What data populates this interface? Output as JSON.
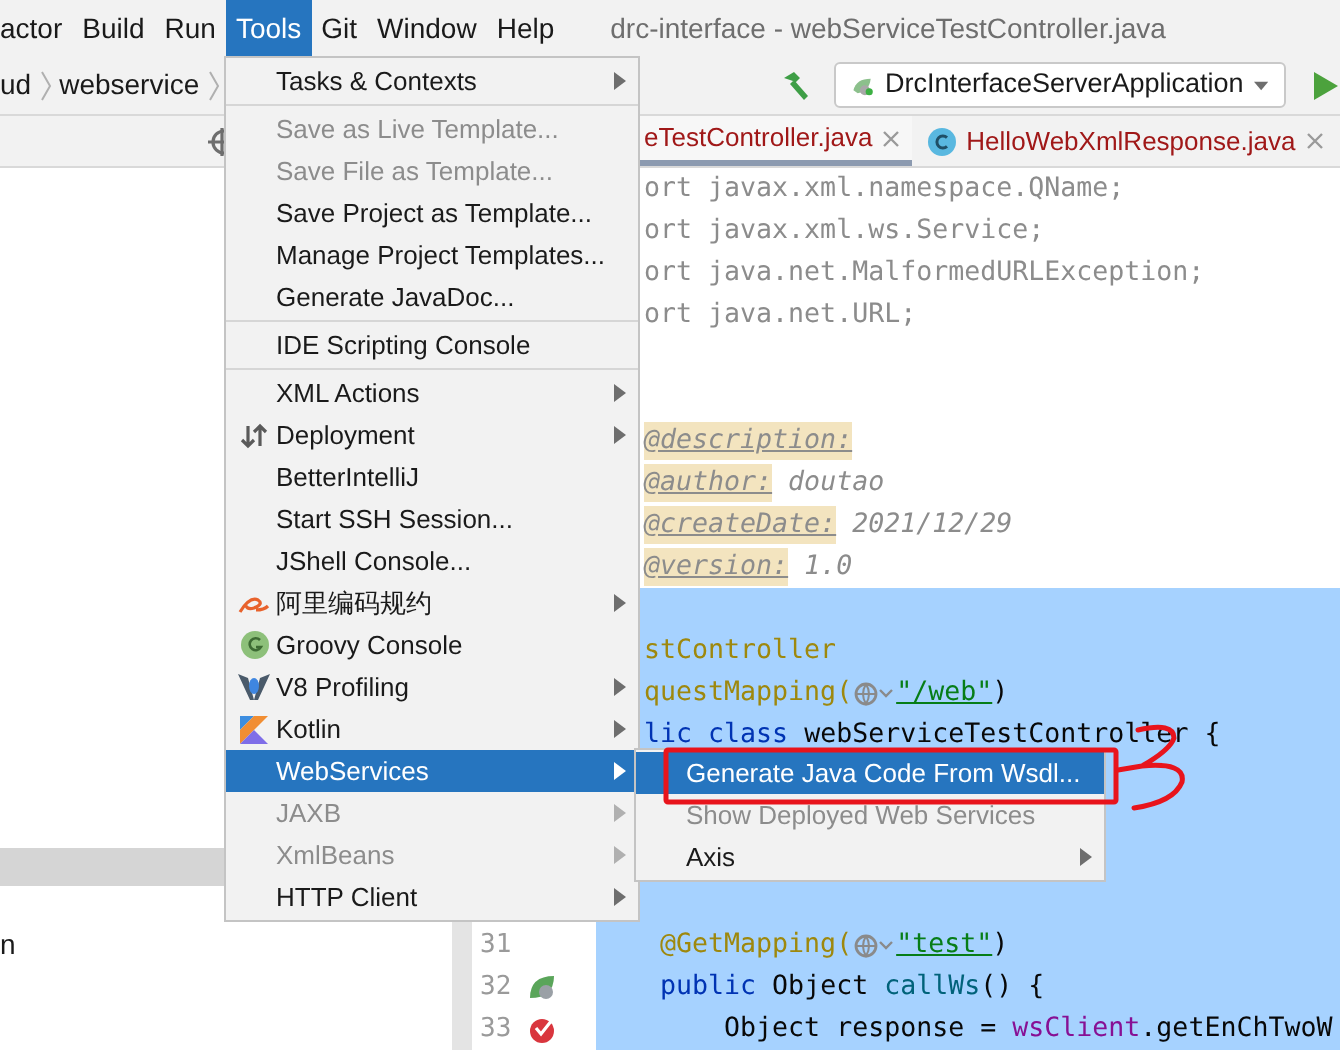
{
  "menu_bar": {
    "items": [
      {
        "label": "actor",
        "selected": false
      },
      {
        "label": "Build",
        "selected": false
      },
      {
        "label": "Run",
        "selected": false
      },
      {
        "label": "Tools",
        "selected": true
      },
      {
        "label": "Git",
        "selected": false
      },
      {
        "label": "Window",
        "selected": false
      },
      {
        "label": "Help",
        "selected": false
      }
    ],
    "title": "drc-interface - webServiceTestController.java"
  },
  "toolbar": {
    "breadcrumbs": [
      "ud",
      "webservice"
    ],
    "run_config": "DrcInterfaceServerApplication"
  },
  "tabs": [
    {
      "label": "eTestController.java",
      "selected": true
    },
    {
      "label": "HelloWebXmlResponse.java",
      "selected": false
    }
  ],
  "project_tree": {
    "rows": [
      {
        "selected": true
      },
      {
        "label": "n",
        "selected": false
      }
    ]
  },
  "editor": {
    "lines": [
      {
        "selected": false,
        "segments": [
          {
            "text": "ort javax.xml.namespace.QName;",
            "kind": "unused"
          }
        ]
      },
      {
        "selected": false,
        "segments": [
          {
            "text": "ort javax.xml.ws.Service;",
            "kind": "unused"
          }
        ]
      },
      {
        "selected": false,
        "segments": [
          {
            "text": "ort java.net.MalformedURLException;",
            "kind": "unused"
          }
        ]
      },
      {
        "selected": false,
        "segments": [
          {
            "text": "ort java.net.URL;",
            "kind": "unused"
          }
        ]
      },
      {
        "selected": false
      },
      {
        "selected": false
      },
      {
        "selected": false,
        "segments": [
          {
            "text": "@description:",
            "kind": "doctag"
          }
        ]
      },
      {
        "selected": false,
        "segments": [
          {
            "text": "@author:",
            "kind": "doctag"
          },
          {
            "text": " doutao",
            "kind": "docvalue"
          }
        ]
      },
      {
        "selected": false,
        "segments": [
          {
            "text": "@createDate:",
            "kind": "doctag"
          },
          {
            "text": " 2021/12/29",
            "kind": "docvalue"
          }
        ]
      },
      {
        "selected": false,
        "segments": [
          {
            "text": "@version:",
            "kind": "doctag"
          },
          {
            "text": " 1.0",
            "kind": "docvalue"
          }
        ]
      },
      {
        "selected": true
      },
      {
        "selected": true,
        "segments": [
          {
            "text": "stController",
            "kind": "annotation"
          }
        ]
      },
      {
        "selected": true,
        "segments": [
          {
            "text": "questMapping(",
            "kind": "annotation"
          },
          {
            "kind": "inlay"
          },
          {
            "text": "\"/web\"",
            "kind": "string"
          },
          {
            "text": ")",
            "kind": "plain"
          }
        ]
      },
      {
        "selected": true,
        "segments": [
          {
            "text": "lic class",
            "kind": "keyword"
          },
          {
            "text": " webServiceTestController {",
            "kind": "plain"
          }
        ]
      },
      {
        "selected": true
      },
      {
        "selected": true
      },
      {
        "selected": true
      },
      {
        "selected": true
      },
      {
        "selected": true,
        "number": "31",
        "segments": [
          {
            "text": " @GetMapping(",
            "kind": "annotation"
          },
          {
            "kind": "inlay"
          },
          {
            "text": "\"test\"",
            "kind": "string"
          },
          {
            "text": ")",
            "kind": "plain"
          }
        ]
      },
      {
        "selected": true,
        "number": "32",
        "marker": {
          "kind": "leaf"
        },
        "segments": [
          {
            "text": " public",
            "kind": "keyword"
          },
          {
            "text": " Object ",
            "kind": "plain"
          },
          {
            "text": "callWs",
            "kind": "method"
          },
          {
            "text": "() {",
            "kind": "plain"
          }
        ]
      },
      {
        "selected": true,
        "number": "33",
        "marker": {
          "kind": "check"
        },
        "segments": [
          {
            "text": "     Object response = ",
            "kind": "plain"
          },
          {
            "text": "wsClient",
            "kind": "field"
          },
          {
            "text": ".getEnChTwoW",
            "kind": "plain"
          }
        ]
      }
    ]
  },
  "tools_menu": {
    "items": [
      {
        "kind": "item",
        "label": "Tasks & Contexts",
        "submenu": true,
        "disabled": false,
        "selected": false
      },
      {
        "kind": "separator"
      },
      {
        "kind": "item",
        "label": "Save as Live Template...",
        "submenu": false,
        "disabled": true,
        "selected": false
      },
      {
        "kind": "item",
        "label": "Save File as Template...",
        "submenu": false,
        "disabled": true,
        "selected": false
      },
      {
        "kind": "item",
        "label": "Save Project as Template...",
        "submenu": false,
        "disabled": false,
        "selected": false
      },
      {
        "kind": "item",
        "label": "Manage Project Templates...",
        "submenu": false,
        "disabled": false,
        "selected": false
      },
      {
        "kind": "item",
        "label": "Generate JavaDoc...",
        "submenu": false,
        "disabled": false,
        "selected": false
      },
      {
        "kind": "separator"
      },
      {
        "kind": "item",
        "label": "IDE Scripting Console",
        "submenu": false,
        "disabled": false,
        "selected": false
      },
      {
        "kind": "separator"
      },
      {
        "kind": "item",
        "label": "XML Actions",
        "submenu": true,
        "disabled": false,
        "selected": false
      },
      {
        "kind": "item",
        "label": "Deployment",
        "icon": {
          "kind": "deploy"
        },
        "submenu": true,
        "disabled": false,
        "selected": false
      },
      {
        "kind": "item",
        "label": "BetterIntelliJ",
        "submenu": false,
        "disabled": false,
        "selected": false
      },
      {
        "kind": "item",
        "label": "Start SSH Session...",
        "submenu": false,
        "disabled": false,
        "selected": false
      },
      {
        "kind": "item",
        "label": "JShell Console...",
        "submenu": false,
        "disabled": false,
        "selected": false
      },
      {
        "kind": "item",
        "label": "阿里编码规约",
        "icon": {
          "kind": "swoosh"
        },
        "submenu": true,
        "disabled": false,
        "selected": false
      },
      {
        "kind": "item",
        "label": "Groovy Console",
        "icon": {
          "kind": "groovy"
        },
        "submenu": false,
        "disabled": false,
        "selected": false
      },
      {
        "kind": "item",
        "label": "V8 Profiling",
        "icon": {
          "kind": "v8"
        },
        "submenu": true,
        "disabled": false,
        "selected": false
      },
      {
        "kind": "item",
        "label": "Kotlin",
        "icon": {
          "kind": "kotlin"
        },
        "submenu": true,
        "disabled": false,
        "selected": false
      },
      {
        "kind": "item",
        "label": "WebServices",
        "submenu": true,
        "disabled": false,
        "selected": true
      },
      {
        "kind": "item",
        "label": "JAXB",
        "submenu": true,
        "disabled": true,
        "selected": false
      },
      {
        "kind": "item",
        "label": "XmlBeans",
        "submenu": true,
        "disabled": true,
        "selected": false
      },
      {
        "kind": "item",
        "label": "HTTP Client",
        "submenu": true,
        "disabled": false,
        "selected": false
      }
    ]
  },
  "webservices_submenu": {
    "items": [
      {
        "kind": "item",
        "label": "Generate Java Code From Wsdl...",
        "submenu": false,
        "disabled": false,
        "selected": true
      },
      {
        "kind": "item",
        "label": "Show Deployed Web Services",
        "submenu": false,
        "disabled": true,
        "selected": false
      },
      {
        "kind": "item",
        "label": "Axis",
        "submenu": true,
        "disabled": false,
        "selected": false
      }
    ]
  }
}
